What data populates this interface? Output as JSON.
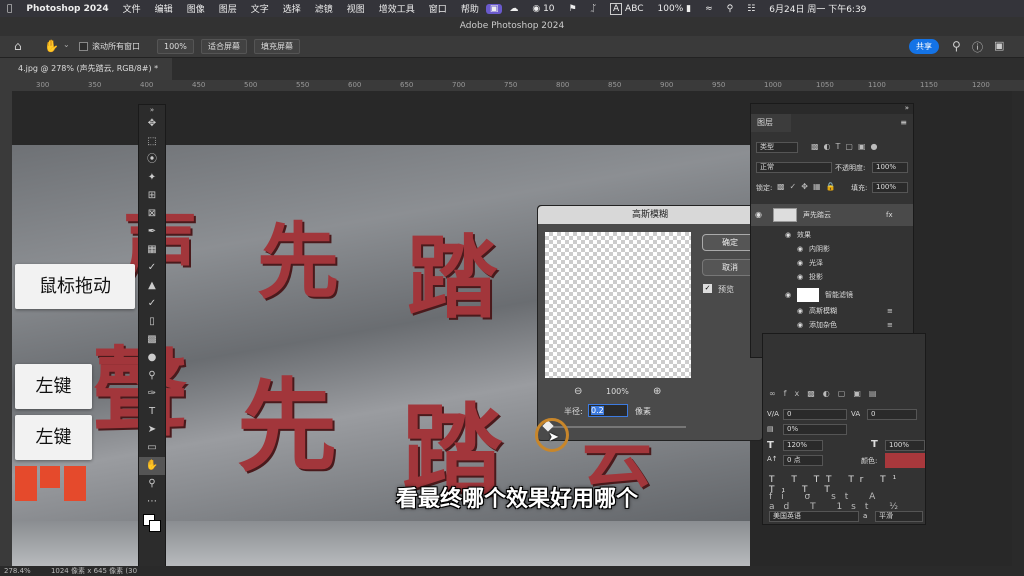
{
  "menubar": {
    "app": "Photoshop 2024",
    "items": [
      "文件",
      "编辑",
      "图像",
      "图层",
      "文字",
      "选择",
      "滤镜",
      "视图",
      "增效工具",
      "窗口",
      "帮助"
    ],
    "right": {
      "wechat_count": "10",
      "input": "ABC",
      "battery": "100%",
      "datetime": "6月24日 周一 下午6:39"
    }
  },
  "titlebar": {
    "title": "Adobe Photoshop 2024"
  },
  "options": {
    "scroll_all": "滚动所有窗口",
    "zoom": "100%",
    "fit_screen": "适合屏幕",
    "fill_screen": "填充屏幕",
    "share": "共享"
  },
  "document_tab": {
    "label": "4.jpg @ 278% (声先踏云, RGB/8#) *"
  },
  "ruler": {
    "marks": [
      "300",
      "350",
      "400",
      "450",
      "500",
      "550",
      "600",
      "650",
      "700",
      "750",
      "800",
      "850",
      "900",
      "950",
      "1000",
      "1050",
      "1100",
      "1150",
      "1200"
    ]
  },
  "overlays": {
    "mouse_drag": "鼠标拖动",
    "left_click_1": "左键",
    "left_click_2": "左键"
  },
  "photo": {
    "row1": [
      "声",
      "先",
      "踏"
    ],
    "row2": [
      "聲",
      "先",
      "踏",
      "云"
    ]
  },
  "dialog": {
    "title": "高斯模糊",
    "ok": "确定",
    "cancel": "取消",
    "preview": "预览",
    "zoom": "100%",
    "radius_label": "半径:",
    "radius_value": "0.2",
    "unit": "像素"
  },
  "layers": {
    "tab": "图层",
    "kind": "类型",
    "blend": "正常",
    "opacity_label": "不透明度:",
    "opacity": "100%",
    "lock_label": "锁定:",
    "fill_label": "填充:",
    "fill": "100%",
    "items": [
      {
        "name": "声先踏云",
        "fx": "fx"
      },
      {
        "name": "效果"
      },
      {
        "name": "内阴影"
      },
      {
        "name": "光泽"
      },
      {
        "name": "投影"
      },
      {
        "name": "智能滤镜"
      },
      {
        "name": "高斯模糊"
      },
      {
        "name": "添加杂色"
      },
      {
        "name": "背景"
      }
    ]
  },
  "character": {
    "tracking1": "0",
    "tracking2": "0",
    "percent": "0%",
    "vscale": "120%",
    "hscale": "100%",
    "baseline": "0 点",
    "color_label": "颜色:",
    "language": "美国英语",
    "aa": "平滑",
    "color": "#a8383c"
  },
  "status": {
    "zoom": "278.4%",
    "size": "1024 像素 x 645 像素 (30"
  },
  "subtitle": {
    "text": "看最终哪个效果好用哪个"
  },
  "colors": {
    "accent": "#1473e6",
    "text_red": "#a2363b",
    "cursor_ring": "#c8862a"
  }
}
